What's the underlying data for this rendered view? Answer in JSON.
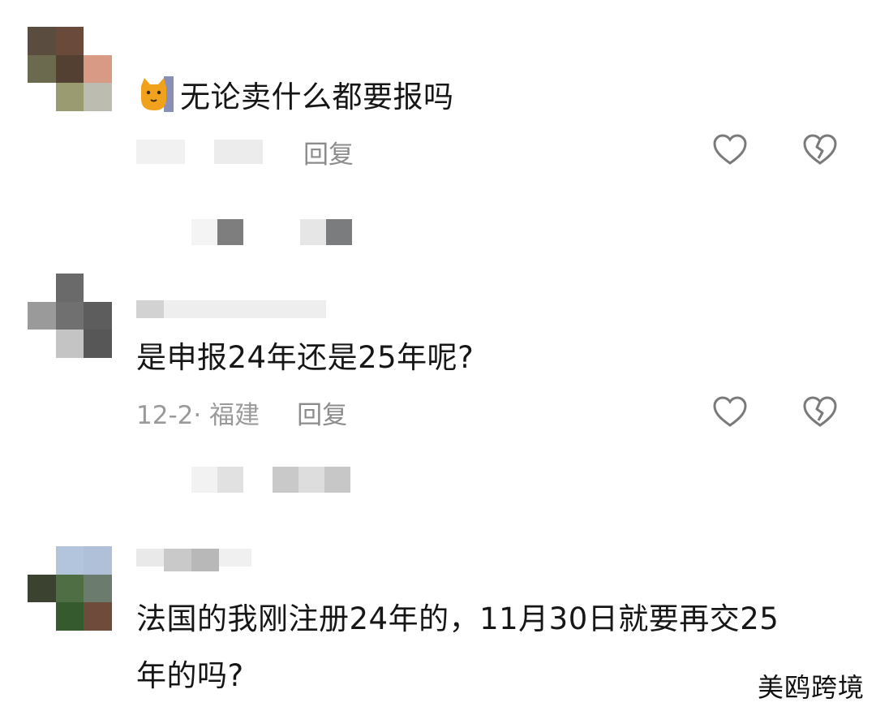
{
  "comments": [
    {
      "text": "无论卖什么都要报吗",
      "meta": "",
      "reply_label": "回复",
      "avatar_colors": [
        "#5a4c3e",
        "#6a4a3b",
        "#ffffff",
        "#6b6a4e",
        "#544032",
        "#d89985",
        "#ffffff",
        "#9b9b71",
        "#bcbcb0"
      ],
      "sub_colors": [
        "#f4f4f4",
        "#7e7e7e",
        "#ffffff",
        "#e6e6e6",
        "#7a7c7d"
      ]
    },
    {
      "text": "是申报24年还是25年呢?",
      "meta": "12-2· 福建",
      "reply_label": "回复",
      "avatar_colors": [
        "#ffffff",
        "#6a6a6a",
        "#ffffff",
        "#9a9a9a",
        "#707070",
        "#5d5d5d",
        "#ffffff",
        "#c4c4c4",
        "#575757"
      ],
      "sub_colors": [
        "#f2f2f2",
        "#e1e1e1",
        "#ffffff",
        "#c9c9c9",
        "#dddddd",
        "#c7c7c7"
      ]
    },
    {
      "text_line1": "法国的我刚注册24年的，11月30日就要再交25",
      "text_line2": "年的吗?",
      "avatar_colors": [
        "#ffffff",
        "#b2c5dc",
        "#b0c0d8",
        "#3b4230",
        "#4f6e44",
        "#6b7c6e",
        "#ffffff",
        "#355a2d",
        "#6f4b3b"
      ]
    }
  ],
  "icons": {
    "like": "heart-icon",
    "dislike": "broken-heart-icon",
    "emoji": "cat-emoji-icon"
  },
  "watermark": "美鸥跨境",
  "colors": {
    "text": "#161616",
    "meta": "#9a9a9a",
    "icon": "#7a7a7a"
  }
}
